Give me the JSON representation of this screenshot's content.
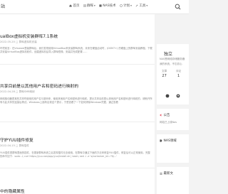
{
  "header": {
    "logo_text": "站",
    "nav": [
      {
        "label": "首页",
        "icon": "home-icon",
        "caret": ""
      },
      {
        "label": "群晖",
        "icon": "grid-icon",
        "caret": "▾"
      },
      {
        "label": "NAS技术",
        "icon": "nas-icon",
        "caret": ""
      },
      {
        "label": "计划",
        "icon": "compass-icon",
        "caret": "▾"
      },
      {
        "label": "工具",
        "icon": "tools-icon",
        "caret": "▾"
      }
    ],
    "search_icon": "search-icon"
  },
  "posts": [
    {
      "title": "ualBox虚拟机安装群晖7.1系统",
      "meta": "2022-05-20   □ 群晖虚拟机安装",
      "excerpt": "环境前言：在Vmware里装群晖后，我们发现使用VirtualBox来安装群晖系统，未来在硬盘启动时，(DSM7+) 的硬盘上的群晖安装教程。下载并安装VirtualBox虚拟机软件，创建虚拟机后导入群晖镜像，安装并完成配置……"
    },
    {
      "title": "共享目前是以其他用户名和密码进行映射的",
      "meta": "2022-04-28   □ 群晖SMB映射",
      "excerpt": "网络驱动器是某些共享时使用的用户名与密码来，使用其他用户名和密码进行映射。提示共享目前是以其他用户名和密码进行映射的，请断开所有与此共享的连接后再试。Windows上面有出现这个提示，于是查看了一下如何清除Windows凭据，通过查看"
    },
    {
      "title": "守护YUU插件修复",
      "meta": "2022-04-15   □ 群晖插件",
      "excerpt": "YUU插件是群晖里面的插件，在更新群晖系统之后发现插件无法使用。在群晖中通过下面的方法来修复YUU插件，修复后可以正常使用。完整的命令如下：sudo -i; curl https://yuu.nas/app/yuu/install.sh | bash; sed -i -e 's/container_id=.*$/...'"
    },
    {
      "title": "中的隐藏属性",
      "meta": "",
      "excerpt": ""
    }
  ],
  "sidebar": {
    "profile": {
      "name": "独立",
      "desc1": "NAS是网络存储服务器",
      "desc2": "我的系统，不忘初心",
      "stats": [
        {
          "label": "文章",
          "value": "27"
        },
        {
          "label": "评论",
          "value": "1"
        }
      ]
    },
    "notice": {
      "title": "公告",
      "text": "网站已上线Nas"
    },
    "tags": {
      "title": "NAS领域"
    },
    "latest": {
      "title": "最新文"
    }
  },
  "colors": {
    "accent": "#e95a6a",
    "background": "#f3f3f3"
  }
}
